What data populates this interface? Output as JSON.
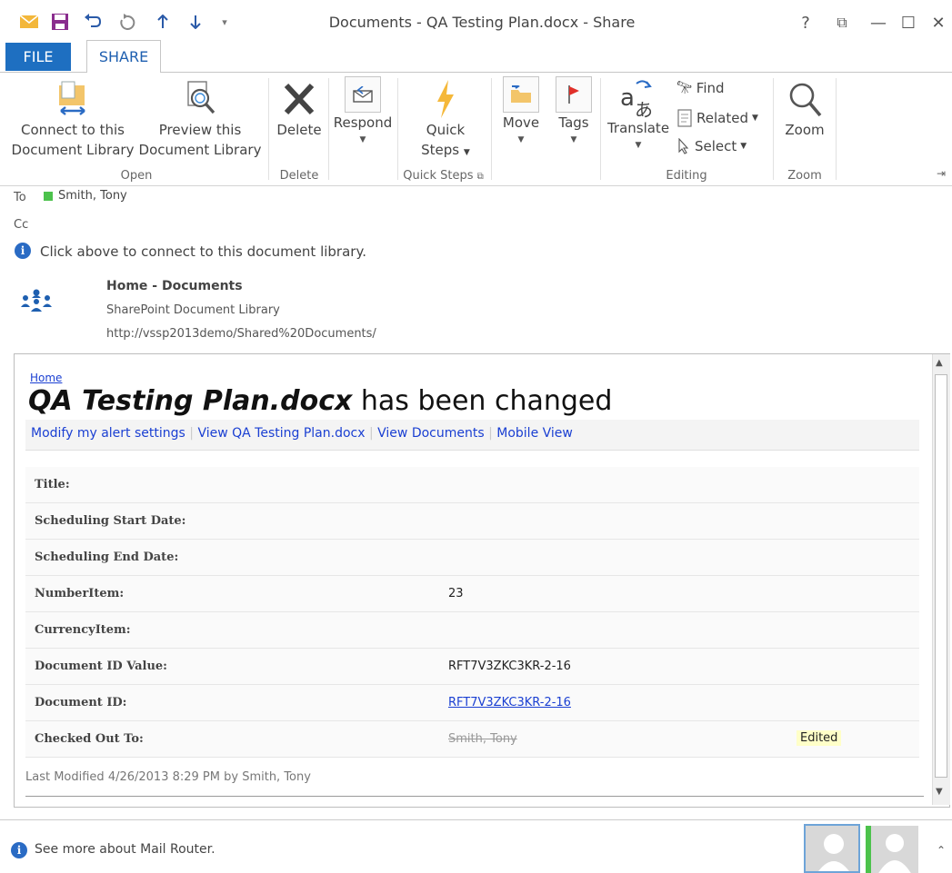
{
  "window": {
    "title": "Documents - QA Testing Plan.docx - Share",
    "help": "?",
    "restore_glyph": "⧉",
    "minimize_glyph": "—",
    "maximize_glyph": "☐",
    "close_glyph": "✕"
  },
  "tabs": {
    "file": "FILE",
    "share": "SHARE"
  },
  "ribbon": {
    "open": {
      "connect_line1": "Connect to this",
      "connect_line2": "Document Library",
      "preview_line1": "Preview this",
      "preview_line2": "Document Library",
      "label": "Open"
    },
    "delete": {
      "button": "Delete",
      "label": "Delete"
    },
    "respond": {
      "button": "Respond"
    },
    "quick_steps": {
      "line1": "Quick",
      "line2": "Steps",
      "label": "Quick Steps"
    },
    "move": {
      "button": "Move"
    },
    "tags": {
      "button": "Tags"
    },
    "editing": {
      "translate": "Translate",
      "find": "Find",
      "related": "Related",
      "select": "Select",
      "label": "Editing"
    },
    "zoom": {
      "button": "Zoom",
      "label": "Zoom"
    }
  },
  "header": {
    "to_label": "To",
    "to_value": "Smith, Tony",
    "cc_label": "Cc",
    "info": "Click above to connect to this document library.",
    "library_title": "Home - Documents",
    "library_type": "SharePoint Document Library",
    "library_url": "http://vssp2013demo/Shared%20Documents/"
  },
  "body": {
    "breadcrumb": "Home",
    "heading_bold": "QA Testing Plan.docx",
    "heading_rest": " has been changed",
    "links": [
      "Modify my alert settings",
      "View QA Testing Plan.docx",
      "View Documents",
      "Mobile View"
    ],
    "link_sep": "|",
    "fields": [
      {
        "name": "Title:",
        "value": ""
      },
      {
        "name": "Scheduling Start Date:",
        "value": ""
      },
      {
        "name": "Scheduling End Date:",
        "value": ""
      },
      {
        "name": "NumberItem:",
        "value": "23"
      },
      {
        "name": "CurrencyItem:",
        "value": ""
      },
      {
        "name": "Document ID Value:",
        "value": "RFT7V3ZKC3KR-2-16"
      },
      {
        "name": "Document ID:",
        "value": "RFT7V3ZKC3KR-2-16"
      },
      {
        "name": "Checked Out To:",
        "value": "Smith, Tony"
      }
    ],
    "edited_badge": "Edited",
    "last_modified": "Last Modified 4/26/2013 8:29 PM by Smith, Tony"
  },
  "footer": {
    "text": "See more about Mail Router."
  },
  "colors": {
    "accent": "#1e6fc1",
    "presence": "#4cc24c",
    "link": "#1a3fd2",
    "edited_bg": "#ffffc8"
  }
}
